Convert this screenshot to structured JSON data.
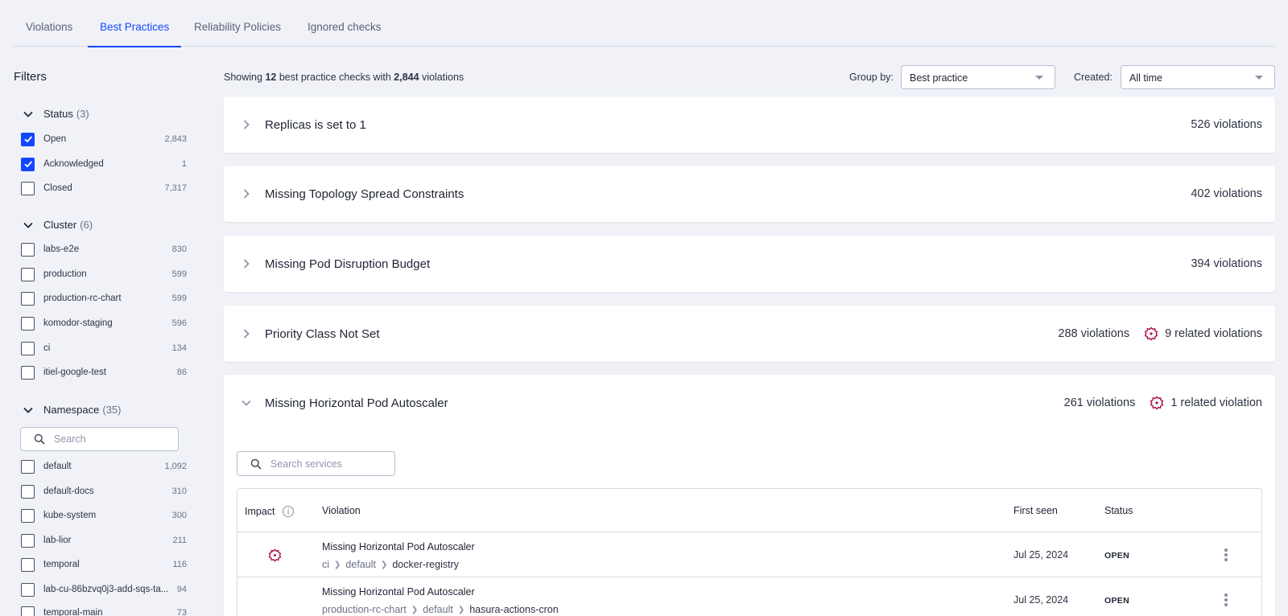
{
  "tabs": [
    "Violations",
    "Best Practices",
    "Reliability Policies",
    "Ignored checks"
  ],
  "filters": {
    "title": "Filters",
    "status": {
      "label": "Status",
      "count": "(3)",
      "items": [
        {
          "label": "Open",
          "count": "2,843",
          "checked": true
        },
        {
          "label": "Acknowledged",
          "count": "1",
          "checked": true
        },
        {
          "label": "Closed",
          "count": "7,317",
          "checked": false
        }
      ]
    },
    "cluster": {
      "label": "Cluster",
      "count": "(6)",
      "items": [
        {
          "label": "labs-e2e",
          "count": "830"
        },
        {
          "label": "production",
          "count": "599"
        },
        {
          "label": "production-rc-chart",
          "count": "599"
        },
        {
          "label": "komodor-staging",
          "count": "596"
        },
        {
          "label": "ci",
          "count": "134"
        },
        {
          "label": "itiel-google-test",
          "count": "86"
        }
      ]
    },
    "namespace": {
      "label": "Namespace",
      "count": "(35)",
      "search_placeholder": "Search",
      "items": [
        {
          "label": "default",
          "count": "1,092"
        },
        {
          "label": "default-docs",
          "count": "310"
        },
        {
          "label": "kube-system",
          "count": "300"
        },
        {
          "label": "lab-lior",
          "count": "211"
        },
        {
          "label": "temporal",
          "count": "116"
        },
        {
          "label": "lab-cu-86bzvq0j3-add-sqs-ta...",
          "count": "94"
        },
        {
          "label": "temporal-main",
          "count": "73"
        }
      ]
    }
  },
  "header": {
    "showing_prefix": "Showing",
    "checks_count": "12",
    "showing_mid": "best practice checks with",
    "violations_count": "2,844",
    "showing_suffix": "violations",
    "group_by_label": "Group by:",
    "group_by_value": "Best practice",
    "created_label": "Created:",
    "created_value": "All time"
  },
  "checks": [
    {
      "title": "Replicas is set to 1",
      "violations": "526 violations",
      "related": ""
    },
    {
      "title": "Missing Topology Spread Constraints",
      "violations": "402 violations",
      "related": ""
    },
    {
      "title": "Missing Pod Disruption Budget",
      "violations": "394 violations",
      "related": ""
    },
    {
      "title": "Priority Class Not Set",
      "violations": "288 violations",
      "related": "9 related violations"
    },
    {
      "title": "Missing Horizontal Pod Autoscaler",
      "violations": "261 violations",
      "related": "1 related violation"
    }
  ],
  "expanded": {
    "search_placeholder": "Search services",
    "columns": {
      "impact": "Impact",
      "violation": "Violation",
      "first_seen": "First seen",
      "status": "Status"
    },
    "rows": [
      {
        "name": "Missing Horizontal Pod Autoscaler",
        "crumbs": [
          "ci",
          "default",
          "docker-registry"
        ],
        "first_seen": "Jul 25, 2024",
        "status": "OPEN",
        "impact": true
      },
      {
        "name": "Missing Horizontal Pod Autoscaler",
        "crumbs": [
          "production-rc-chart",
          "default",
          "hasura-actions-cron"
        ],
        "first_seen": "Jul 25, 2024",
        "status": "OPEN",
        "impact": false
      }
    ]
  },
  "colors": {
    "accent": "#1347ff",
    "impact": "#b0154a"
  }
}
